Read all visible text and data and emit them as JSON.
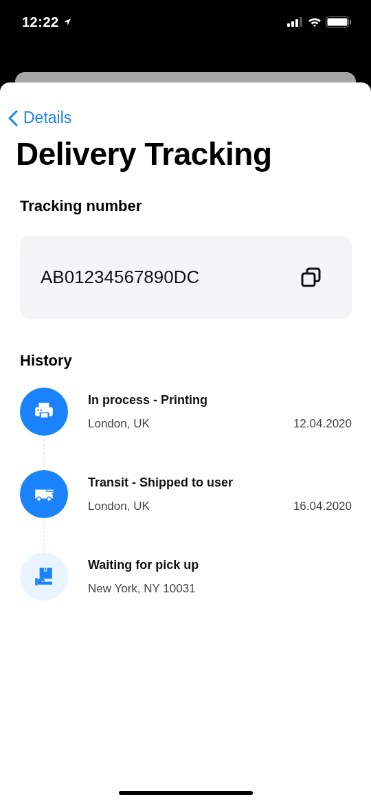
{
  "status_bar": {
    "time": "12:22"
  },
  "nav": {
    "back_label": "Details"
  },
  "title": "Delivery Tracking",
  "tracking": {
    "label": "Tracking number",
    "number": "AB01234567890DC"
  },
  "history": {
    "title": "History",
    "items": [
      {
        "kind": "printer",
        "done": true,
        "title": "In process - Printing",
        "location": "London, UK",
        "date": "12.04.2020"
      },
      {
        "kind": "truck",
        "done": true,
        "title": "Transit - Shipped to user",
        "location": "London, UK",
        "date": "16.04.2020"
      },
      {
        "kind": "pickup",
        "done": false,
        "title": "Waiting for pick up",
        "location": "New York, NY 10031"
      }
    ]
  }
}
